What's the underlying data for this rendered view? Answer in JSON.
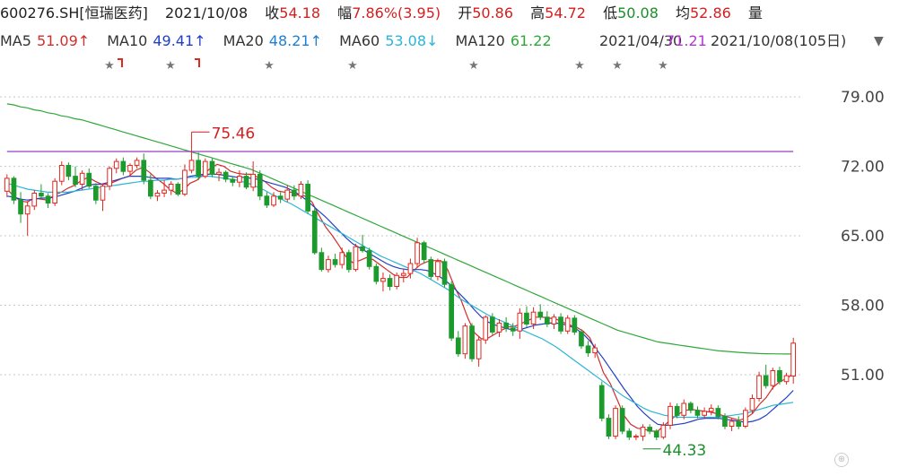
{
  "header": {
    "code_name": "600276.SH[恒瑞医药]",
    "date": "2021/10/08",
    "close_label": "收",
    "close_value": "54.18",
    "change_label": "幅",
    "change_value": "7.86%(3.95)",
    "open_label": "开",
    "open_value": "50.86",
    "high_label": "高",
    "high_value": "54.72",
    "low_label": "低",
    "low_value": "50.08",
    "avg_label": "均",
    "avg_value": "52.86",
    "volume_label": "量"
  },
  "ma_legend": {
    "ma5_label": "MA5",
    "ma5_value": "51.09↑",
    "ma10_label": "MA10",
    "ma10_value": "49.41↑",
    "ma20_label": "MA20",
    "ma20_value": "48.21↑",
    "ma60_label": "MA60",
    "ma60_value": "53.08↓",
    "ma120_label": "MA120",
    "ma120_value": "61.22",
    "ma250_overlap_text": "2021/04/30",
    "ma250_value": "71.21",
    "range_text": "2021/10/08(105日)"
  },
  "colors": {
    "up": "#e0281f",
    "down": "#1d9a2d",
    "ma5": "#d12d2d",
    "ma10": "#2340c4",
    "ma20": "#2bb5d6",
    "ma60": "#2fa83a",
    "ma120": "#9a3fc8",
    "grid": "#c8c8c8",
    "axis_text": "#444444",
    "star": "#777777"
  },
  "chart_data": {
    "type": "candlestick",
    "y_ticks": [
      "79.00",
      "72.00",
      "65.00",
      "58.00",
      "51.00"
    ],
    "ylim": [
      42.5,
      81.0
    ],
    "grid": true,
    "annotations": [
      {
        "label": "75.46",
        "type": "high_marker"
      },
      {
        "label": "44.33",
        "type": "low_marker"
      }
    ],
    "markers": [
      "star",
      "flag",
      "star",
      "flag",
      "star",
      "star",
      "star",
      "star",
      "star",
      "star"
    ],
    "ohlc": [
      [
        69.5,
        71.2,
        68.9,
        70.8
      ],
      [
        70.8,
        71.0,
        68.2,
        68.6
      ],
      [
        68.6,
        69.4,
        66.3,
        67.2
      ],
      [
        67.2,
        68.5,
        65.0,
        68.0
      ],
      [
        68.0,
        69.6,
        67.6,
        69.3
      ],
      [
        69.3,
        70.2,
        68.7,
        69.0
      ],
      [
        69.0,
        69.3,
        67.8,
        68.3
      ],
      [
        68.3,
        70.8,
        68.0,
        70.5
      ],
      [
        70.5,
        72.5,
        70.1,
        72.1
      ],
      [
        72.1,
        72.4,
        70.6,
        71.0
      ],
      [
        71.0,
        72.0,
        69.9,
        70.2
      ],
      [
        70.2,
        71.6,
        69.6,
        71.3
      ],
      [
        71.3,
        71.8,
        69.8,
        70.0
      ],
      [
        70.0,
        70.3,
        68.2,
        68.6
      ],
      [
        68.6,
        70.3,
        67.5,
        70.0
      ],
      [
        70.0,
        72.0,
        69.6,
        71.8
      ],
      [
        71.8,
        72.8,
        71.3,
        72.5
      ],
      [
        72.5,
        72.9,
        71.1,
        71.5
      ],
      [
        71.5,
        72.3,
        71.0,
        72.1
      ],
      [
        72.1,
        72.9,
        71.8,
        72.6
      ],
      [
        72.6,
        73.3,
        70.2,
        70.6
      ],
      [
        70.6,
        71.2,
        68.7,
        69.0
      ],
      [
        69.0,
        69.6,
        68.5,
        69.3
      ],
      [
        69.3,
        70.6,
        68.9,
        69.6
      ],
      [
        69.6,
        70.5,
        69.1,
        70.2
      ],
      [
        70.2,
        70.4,
        69.0,
        69.2
      ],
      [
        69.2,
        72.2,
        69.0,
        71.6
      ],
      [
        71.6,
        75.46,
        71.3,
        72.6
      ],
      [
        72.6,
        73.4,
        70.6,
        71.0
      ],
      [
        71.0,
        72.8,
        70.8,
        72.5
      ],
      [
        72.5,
        72.8,
        70.9,
        71.2
      ],
      [
        71.2,
        71.8,
        70.5,
        71.4
      ],
      [
        71.4,
        71.6,
        70.4,
        70.7
      ],
      [
        70.7,
        71.0,
        70.0,
        70.4
      ],
      [
        70.4,
        71.6,
        69.9,
        71.0
      ],
      [
        71.0,
        71.4,
        69.7,
        69.9
      ],
      [
        69.9,
        72.5,
        69.5,
        71.2
      ],
      [
        71.2,
        71.6,
        68.6,
        69.0
      ],
      [
        69.0,
        69.4,
        67.8,
        68.1
      ],
      [
        68.1,
        69.4,
        67.9,
        69.0
      ],
      [
        69.0,
        69.4,
        68.3,
        68.7
      ],
      [
        68.7,
        70.1,
        68.4,
        69.6
      ],
      [
        69.6,
        70.1,
        68.6,
        69.0
      ],
      [
        69.0,
        70.5,
        68.7,
        70.2
      ],
      [
        70.2,
        70.6,
        67.2,
        67.5
      ],
      [
        67.5,
        67.8,
        63.1,
        63.3
      ],
      [
        63.3,
        63.8,
        61.4,
        61.6
      ],
      [
        61.6,
        63.0,
        61.3,
        62.6
      ],
      [
        62.6,
        63.2,
        61.8,
        62.1
      ],
      [
        62.1,
        63.8,
        61.7,
        63.3
      ],
      [
        63.3,
        63.6,
        61.3,
        61.6
      ],
      [
        61.6,
        64.2,
        61.4,
        63.9
      ],
      [
        63.9,
        65.1,
        63.3,
        63.5
      ],
      [
        63.5,
        63.8,
        61.6,
        61.9
      ],
      [
        61.9,
        62.2,
        60.1,
        60.4
      ],
      [
        60.4,
        61.3,
        59.4,
        60.7
      ],
      [
        60.7,
        61.1,
        59.5,
        59.9
      ],
      [
        59.9,
        61.3,
        59.6,
        61.0
      ],
      [
        61.0,
        61.6,
        60.3,
        61.2
      ],
      [
        61.2,
        62.7,
        60.7,
        62.2
      ],
      [
        62.2,
        64.8,
        61.8,
        64.3
      ],
      [
        64.3,
        64.5,
        62.2,
        62.6
      ],
      [
        62.6,
        62.9,
        60.6,
        60.9
      ],
      [
        60.9,
        62.7,
        60.5,
        62.4
      ],
      [
        62.4,
        62.7,
        59.8,
        60.1
      ],
      [
        60.1,
        60.4,
        54.4,
        54.7
      ],
      [
        54.7,
        55.4,
        52.8,
        53.1
      ],
      [
        53.1,
        56.2,
        52.6,
        55.9
      ],
      [
        55.9,
        56.2,
        52.3,
        52.6
      ],
      [
        52.6,
        54.8,
        51.8,
        54.5
      ],
      [
        54.5,
        57.0,
        54.1,
        56.8
      ],
      [
        56.8,
        57.2,
        55.0,
        55.3
      ],
      [
        55.3,
        56.6,
        54.8,
        56.2
      ],
      [
        56.2,
        56.8,
        55.3,
        55.7
      ],
      [
        55.7,
        56.2,
        54.9,
        55.4
      ],
      [
        55.4,
        57.7,
        54.6,
        57.2
      ],
      [
        57.2,
        57.9,
        55.8,
        56.1
      ],
      [
        56.1,
        57.8,
        55.6,
        57.3
      ],
      [
        57.3,
        58.1,
        56.5,
        56.8
      ],
      [
        56.8,
        57.4,
        55.8,
        56.1
      ],
      [
        56.1,
        57.1,
        55.6,
        56.8
      ],
      [
        56.8,
        57.2,
        55.1,
        55.4
      ],
      [
        55.4,
        57.0,
        55.1,
        56.7
      ],
      [
        56.7,
        57.0,
        55.0,
        55.3
      ],
      [
        55.3,
        55.6,
        53.6,
        53.9
      ],
      [
        53.9,
        54.4,
        52.8,
        53.2
      ],
      [
        53.2,
        54.1,
        52.7,
        53.7
      ],
      [
        49.9,
        50.3,
        46.3,
        46.6
      ],
      [
        46.6,
        47.0,
        44.5,
        44.8
      ],
      [
        44.8,
        47.9,
        44.5,
        47.6
      ],
      [
        47.6,
        47.9,
        45.0,
        45.3
      ],
      [
        45.3,
        45.6,
        44.4,
        44.7
      ],
      [
        44.7,
        45.0,
        44.4,
        44.8
      ],
      [
        44.8,
        46.0,
        44.33,
        45.7
      ],
      [
        45.7,
        46.0,
        45.0,
        45.3
      ],
      [
        45.3,
        45.5,
        44.4,
        44.7
      ],
      [
        44.7,
        46.2,
        44.5,
        45.9
      ],
      [
        45.9,
        48.2,
        45.5,
        47.8
      ],
      [
        47.8,
        48.1,
        46.6,
        46.9
      ],
      [
        46.9,
        48.5,
        46.5,
        48.1
      ],
      [
        48.1,
        48.3,
        47.1,
        47.4
      ],
      [
        47.4,
        47.8,
        46.6,
        46.9
      ],
      [
        46.9,
        47.7,
        46.6,
        47.3
      ],
      [
        47.3,
        48.0,
        46.9,
        47.6
      ],
      [
        47.6,
        47.9,
        46.5,
        46.8
      ],
      [
        46.8,
        47.1,
        45.5,
        45.8
      ],
      [
        45.8,
        46.6,
        45.3,
        46.3
      ],
      [
        46.3,
        46.8,
        45.5,
        45.8
      ],
      [
        45.8,
        47.7,
        45.6,
        47.4
      ],
      [
        47.4,
        49.0,
        47.1,
        48.6
      ],
      [
        48.6,
        51.3,
        48.3,
        50.9
      ],
      [
        50.9,
        52.0,
        49.6,
        49.9
      ],
      [
        49.9,
        51.7,
        49.5,
        51.4
      ],
      [
        51.4,
        51.8,
        50.0,
        50.3
      ],
      [
        50.3,
        51.2,
        50.0,
        50.9
      ],
      [
        50.86,
        54.72,
        50.08,
        54.18
      ]
    ],
    "ma_series": [
      {
        "name": "MA5",
        "values": [
          69.7,
          69.0,
          68.5,
          68.4,
          68.8,
          68.7,
          68.6,
          69.1,
          69.4,
          69.8,
          70.1,
          70.6,
          70.9,
          70.5,
          70.2,
          70.2,
          70.5,
          70.8,
          71.0,
          71.6,
          71.9,
          71.4,
          70.8,
          70.3,
          69.7,
          69.3,
          69.6,
          70.3,
          70.6,
          71.2,
          71.8,
          72.2,
          72.0,
          71.5,
          71.3,
          71.2,
          71.2,
          70.9,
          70.5,
          69.9,
          69.5,
          69.4,
          69.4,
          69.1,
          69.0,
          68.4,
          67.1,
          65.9,
          65.0,
          64.0,
          62.9,
          62.3,
          62.5,
          62.8,
          62.6,
          62.1,
          61.6,
          61.1,
          60.8,
          60.8,
          61.5,
          62.1,
          62.4,
          62.5,
          62.5,
          61.6,
          59.9,
          58.5,
          56.7,
          55.2,
          54.6,
          54.7,
          55.1,
          55.5,
          55.8,
          55.9,
          56.2,
          56.5,
          56.8,
          56.8,
          56.7,
          56.6,
          56.3,
          56.0,
          55.8,
          55.4,
          54.7,
          53.1,
          51.2,
          50.1,
          48.5,
          46.9,
          46.0,
          45.6,
          45.5,
          45.3,
          45.3,
          45.9,
          46.5,
          47.0,
          47.4,
          47.5,
          47.4,
          47.3,
          47.2,
          47.0,
          46.8,
          46.6,
          46.4,
          46.6,
          47.1,
          48.0,
          48.7,
          49.7,
          50.3,
          50.6,
          51.09
        ]
      },
      {
        "name": "MA10",
        "values": [
          69.0,
          68.9,
          68.7,
          68.6,
          68.7,
          68.8,
          68.8,
          68.9,
          69.1,
          69.3,
          69.5,
          69.8,
          70.1,
          70.2,
          70.2,
          70.4,
          70.6,
          70.8,
          71.0,
          71.0,
          71.0,
          70.9,
          70.8,
          70.8,
          70.8,
          70.7,
          70.8,
          71.0,
          71.1,
          71.2,
          71.2,
          71.2,
          71.1,
          71.0,
          70.9,
          70.9,
          70.8,
          70.7,
          70.5,
          70.3,
          70.1,
          69.9,
          69.6,
          69.2,
          68.7,
          68.1,
          67.5,
          66.9,
          66.2,
          65.5,
          64.8,
          64.2,
          63.8,
          63.4,
          63.0,
          62.6,
          62.2,
          61.9,
          61.7,
          61.6,
          61.6,
          61.6,
          61.5,
          61.2,
          60.8,
          60.3,
          59.7,
          59.0,
          58.3,
          57.5,
          56.8,
          56.3,
          56.0,
          55.8,
          55.6,
          55.5,
          55.6,
          55.8,
          56.0,
          56.1,
          56.2,
          56.2,
          56.1,
          55.9,
          55.6,
          55.1,
          54.4,
          53.5,
          52.6,
          51.6,
          50.6,
          49.6,
          48.7,
          47.8,
          47.1,
          46.5,
          46.0,
          45.9,
          45.9,
          46.0,
          46.1,
          46.3,
          46.5,
          46.6,
          46.6,
          46.6,
          46.5,
          46.4,
          46.3,
          46.2,
          46.3,
          46.5,
          46.9,
          47.5,
          48.1,
          48.7,
          49.41
        ]
      },
      {
        "name": "MA20",
        "values": [
          70.3,
          70.1,
          69.9,
          69.7,
          69.6,
          69.5,
          69.4,
          69.4,
          69.4,
          69.4,
          69.5,
          69.6,
          69.7,
          69.8,
          69.9,
          70.0,
          70.1,
          70.2,
          70.3,
          70.4,
          70.5,
          70.5,
          70.6,
          70.6,
          70.7,
          70.7,
          70.8,
          70.9,
          70.9,
          71.0,
          71.0,
          70.9,
          70.8,
          70.7,
          70.6,
          70.4,
          70.2,
          69.9,
          69.6,
          69.2,
          68.9,
          68.5,
          68.2,
          67.8,
          67.4,
          67.0,
          66.6,
          66.2,
          65.8,
          65.4,
          65.0,
          64.6,
          64.2,
          63.8,
          63.4,
          63.0,
          62.7,
          62.4,
          62.1,
          61.8,
          61.5,
          61.2,
          60.8,
          60.4,
          60.0,
          59.6,
          59.1,
          58.6,
          58.2,
          57.8,
          57.4,
          57.0,
          56.7,
          56.4,
          56.1,
          55.8,
          55.5,
          55.2,
          54.9,
          54.6,
          54.2,
          53.8,
          53.3,
          52.8,
          52.3,
          51.8,
          51.3,
          50.8,
          50.3,
          49.8,
          49.3,
          48.8,
          48.4,
          48.0,
          47.6,
          47.3,
          47.1,
          46.9,
          46.8,
          46.7,
          46.7,
          46.7,
          46.7,
          46.7,
          46.7,
          46.7,
          46.8,
          46.9,
          47.0,
          47.1,
          47.3,
          47.5,
          47.7,
          47.9,
          48.0,
          48.1,
          48.21
        ]
      },
      {
        "name": "MA60",
        "values": [
          78.3,
          78.2,
          78.0,
          77.9,
          77.7,
          77.6,
          77.4,
          77.3,
          77.1,
          77.0,
          76.8,
          76.7,
          76.5,
          76.3,
          76.1,
          75.9,
          75.7,
          75.5,
          75.3,
          75.1,
          74.9,
          74.7,
          74.5,
          74.3,
          74.1,
          73.9,
          73.7,
          73.5,
          73.3,
          73.1,
          72.9,
          72.7,
          72.5,
          72.3,
          72.1,
          71.9,
          71.7,
          71.4,
          71.1,
          70.8,
          70.5,
          70.2,
          69.9,
          69.6,
          69.3,
          69.0,
          68.7,
          68.4,
          68.1,
          67.8,
          67.5,
          67.2,
          66.9,
          66.6,
          66.3,
          66.0,
          65.7,
          65.4,
          65.1,
          64.8,
          64.5,
          64.2,
          63.9,
          63.6,
          63.3,
          63.0,
          62.7,
          62.4,
          62.1,
          61.8,
          61.5,
          61.2,
          60.9,
          60.6,
          60.3,
          60.0,
          59.7,
          59.4,
          59.1,
          58.8,
          58.5,
          58.2,
          57.9,
          57.6,
          57.3,
          57.0,
          56.7,
          56.4,
          56.1,
          55.8,
          55.5,
          55.3,
          55.1,
          54.9,
          54.7,
          54.5,
          54.3,
          54.2,
          54.1,
          54.0,
          53.9,
          53.8,
          53.7,
          53.6,
          53.5,
          53.4,
          53.35,
          53.3,
          53.25,
          53.2,
          53.16,
          53.13,
          53.11,
          53.1,
          53.09,
          53.085,
          53.08
        ]
      },
      {
        "name": "MA120",
        "values": [
          73.5,
          73.5,
          73.5,
          73.5,
          73.5,
          73.5,
          73.5,
          73.5,
          73.5,
          73.5,
          73.5,
          73.5,
          73.5,
          73.5,
          73.5,
          73.5,
          73.5,
          73.5,
          73.5,
          73.5,
          73.5,
          73.5,
          73.5,
          73.5,
          73.5,
          73.5,
          73.5,
          73.5,
          73.5,
          73.5,
          73.5,
          73.5,
          73.5,
          73.5,
          73.5,
          73.5,
          73.5,
          73.5,
          73.5,
          73.5,
          73.5,
          73.5,
          73.5,
          73.5,
          73.5,
          73.5,
          73.5,
          73.5,
          73.5,
          73.5,
          73.5,
          73.5,
          73.5,
          73.5,
          73.5,
          73.5,
          73.5,
          73.5,
          73.5,
          73.5,
          73.5,
          73.5,
          73.5,
          73.5,
          73.5,
          73.5,
          73.5,
          73.5,
          73.5,
          73.5,
          73.5,
          73.5,
          73.5,
          73.5,
          73.5,
          73.5,
          73.5,
          73.5,
          73.5,
          73.5,
          73.5,
          73.5,
          73.5,
          73.5,
          73.5,
          73.5,
          73.5,
          73.5,
          73.5,
          73.5,
          73.5,
          73.5,
          73.5,
          73.5,
          73.5,
          73.5,
          73.5,
          73.5,
          73.5,
          73.5,
          73.5,
          73.5,
          73.5,
          73.5,
          73.5,
          73.5,
          73.5,
          73.5,
          73.5,
          73.5,
          73.5,
          73.5,
          73.5,
          73.5,
          73.5,
          73.5,
          73.5
        ]
      }
    ]
  }
}
